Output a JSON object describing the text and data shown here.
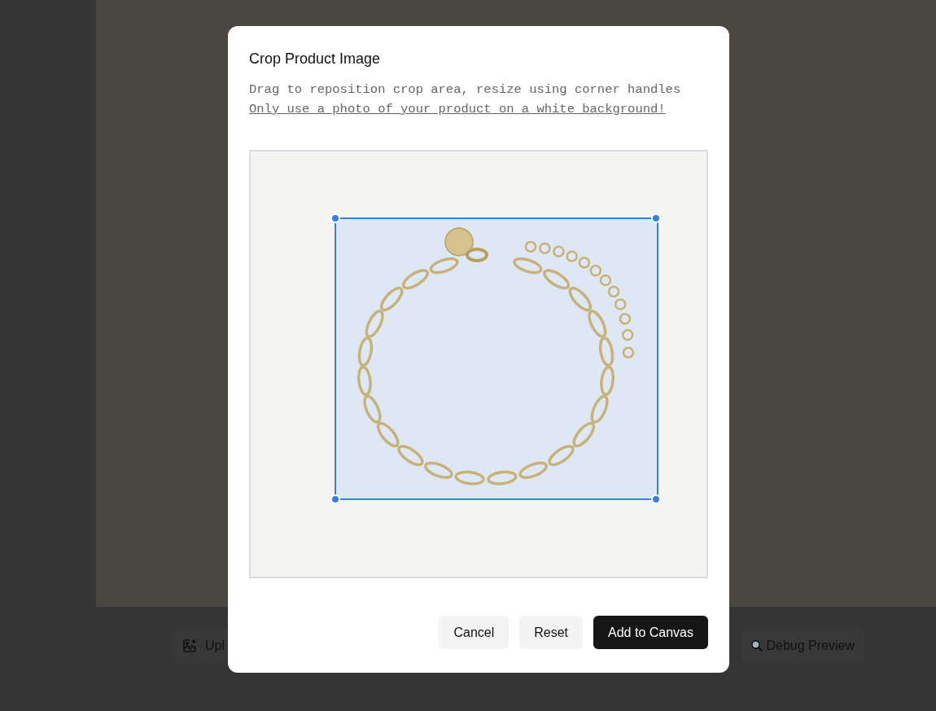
{
  "background": {
    "buttons": [
      {
        "label": "Upl",
        "kind": "upload"
      },
      {
        "label": "Debug Preview",
        "kind": "debug"
      }
    ]
  },
  "dialog": {
    "title": "Crop Product Image",
    "instructions": "Drag to reposition crop area, resize using corner handles",
    "warning": "Only use a photo of your product on a white background!",
    "buttons": [
      {
        "label": "Cancel",
        "kind": "secondary"
      },
      {
        "label": "Reset",
        "kind": "secondary"
      },
      {
        "label": "Add to Canvas",
        "kind": "primary"
      }
    ]
  }
}
